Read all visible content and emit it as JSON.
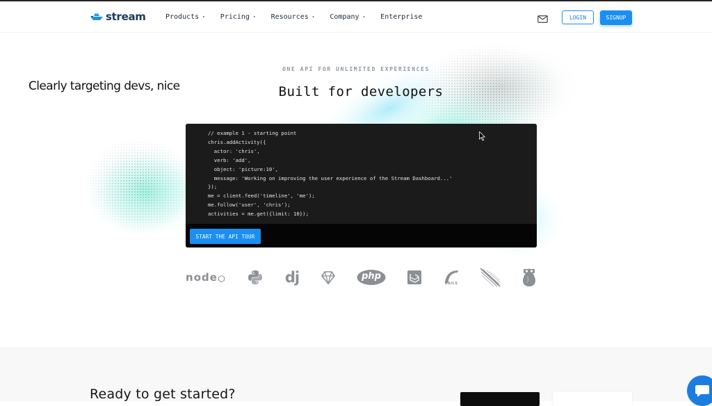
{
  "colors": {
    "accent": "#1b8ef2",
    "code_bg": "#1b1b1b",
    "footer_bg": "#f8f8f8"
  },
  "brand": {
    "name": "stream"
  },
  "nav": {
    "items": [
      {
        "label": "Products",
        "has_dropdown": true
      },
      {
        "label": "Pricing",
        "has_dropdown": true
      },
      {
        "label": "Resources",
        "has_dropdown": true
      },
      {
        "label": "Company",
        "has_dropdown": true
      },
      {
        "label": "Enterprise",
        "has_dropdown": false
      }
    ],
    "caret": "▾",
    "mail_icon": "mail-icon",
    "login_label": "LOGIN",
    "signup_label": "SIGNUP"
  },
  "annotation": "Clearly targeting devs, nice",
  "hero": {
    "eyebrow": "ONE API FOR UNLIMITED EXPERIENCES",
    "headline": "Built for developers"
  },
  "code": {
    "lines": [
      "// example 1 - starting point",
      "chris.addActivity({",
      "  actor: 'chris',",
      "  verb: 'add',",
      "  object: 'picture:10',",
      "  message: 'Working on improving the user experience of the Stream Dashboard...'",
      "});",
      "me = client.feed('timeline', 'me');",
      "me.follow('user', 'chris');",
      "activities = me.get({limit: 10});"
    ],
    "tour_button": "START THE API TOUR"
  },
  "tech_logos": [
    {
      "icon": "nodejs-icon",
      "text": "node"
    },
    {
      "icon": "python-icon",
      "text": ""
    },
    {
      "icon": "django-icon",
      "text": "dj"
    },
    {
      "icon": "ruby-icon",
      "text": ""
    },
    {
      "icon": "php-icon",
      "text": "php"
    },
    {
      "icon": "laravel-icon",
      "text": ""
    },
    {
      "icon": "rails-icon",
      "text": "RAILS"
    },
    {
      "icon": "meteor-icon",
      "text": ""
    },
    {
      "icon": "elixir-icon",
      "text": ""
    }
  ],
  "cta": {
    "title": "Ready to get started?"
  },
  "chat": {
    "icon": "chat-icon"
  }
}
